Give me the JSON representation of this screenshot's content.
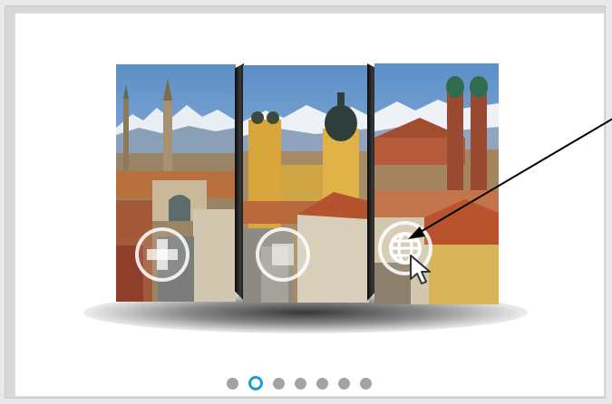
{
  "carousel": {
    "slide_count": 7,
    "active_index": 1,
    "slide_image": "munich-city-panorama",
    "buttons": [
      {
        "name": "add-button",
        "icon": "plus-icon"
      },
      {
        "name": "stop-button",
        "icon": "square-stop-icon"
      },
      {
        "name": "globe-button",
        "icon": "globe-icon"
      }
    ]
  },
  "annotation": {
    "type": "arrow",
    "target": "globe-button"
  },
  "colors": {
    "active_dot": "#1e9bd7",
    "inactive_dot": "#a3a3a3",
    "panel_background": "#ffffff"
  }
}
